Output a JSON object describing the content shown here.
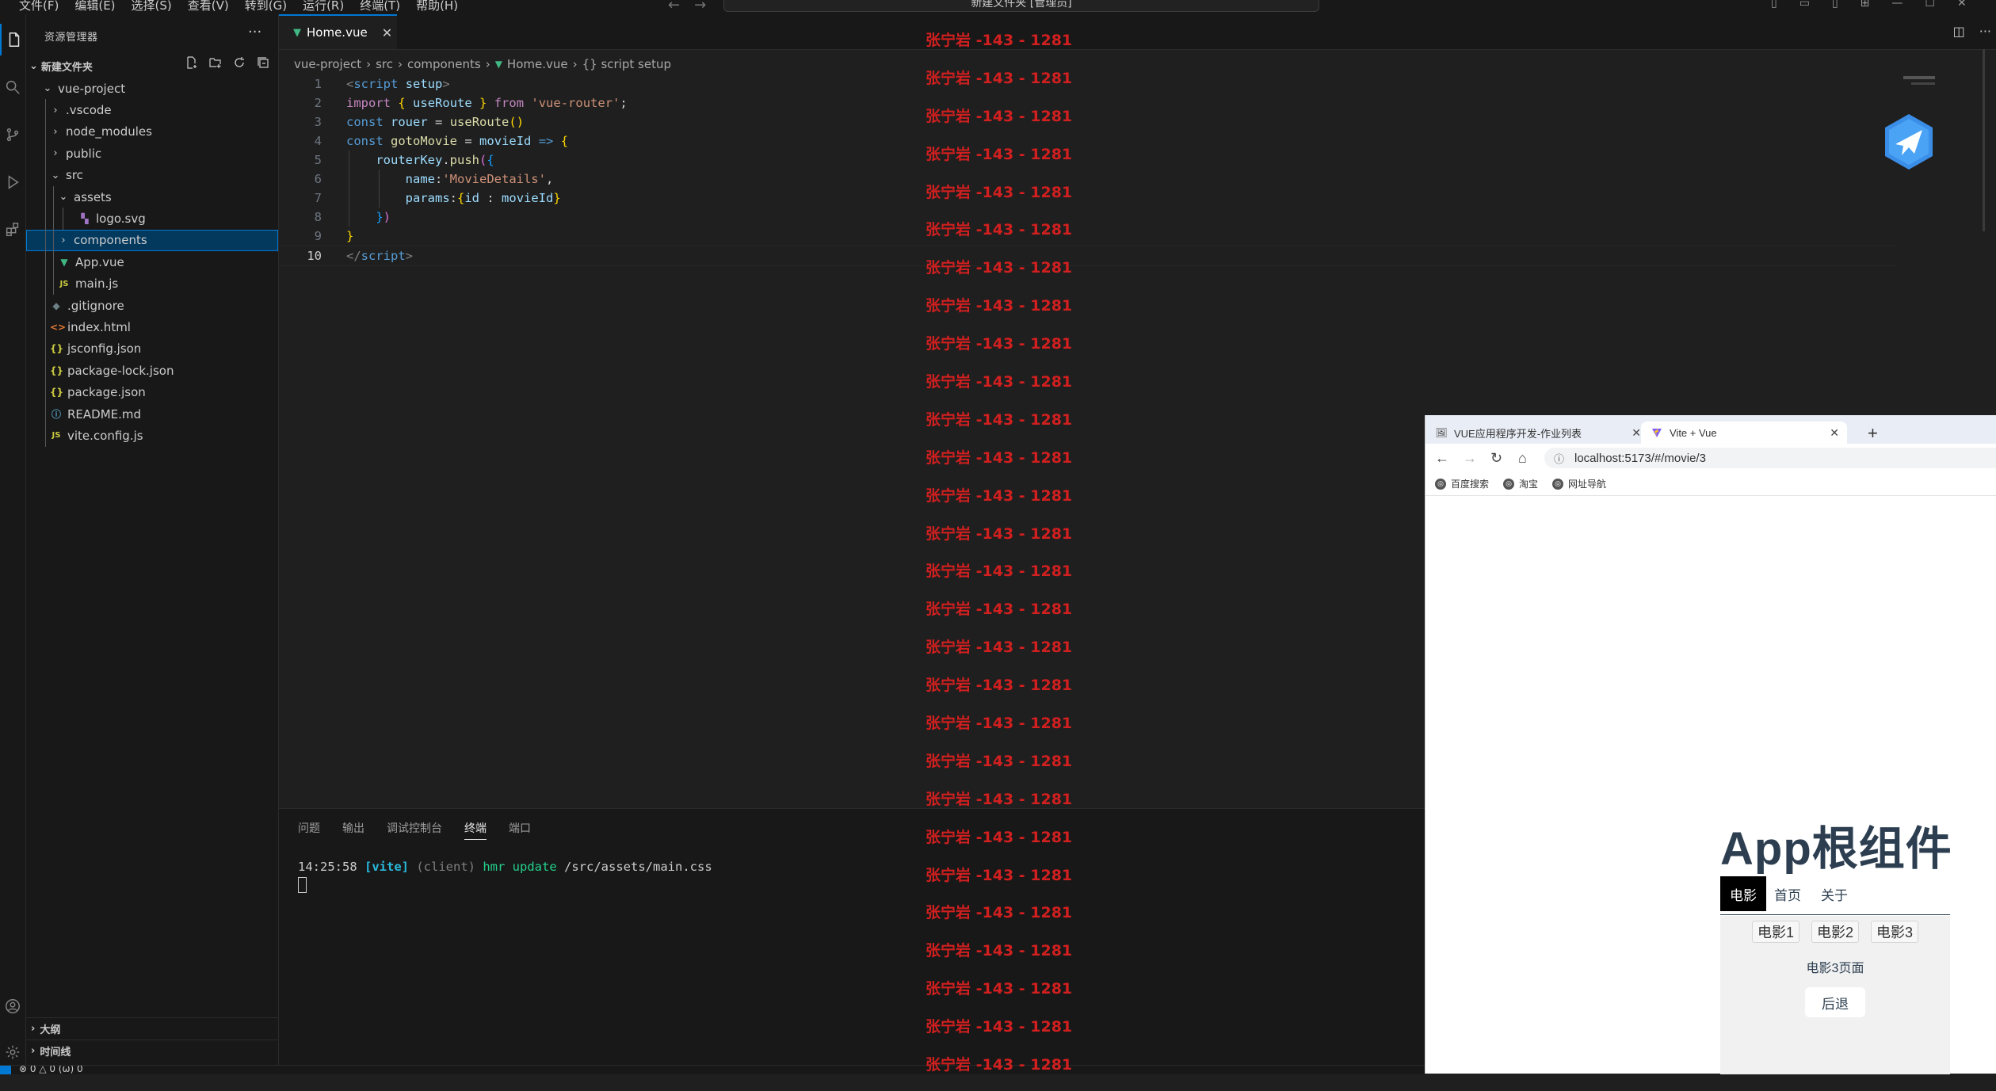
{
  "menu": [
    "文件(F)",
    "编辑(E)",
    "选择(S)",
    "查看(V)",
    "转到(G)",
    "运行(R)",
    "终端(T)",
    "帮助(H)"
  ],
  "command_center": "新建文件夹 [管理员]",
  "sidebar": {
    "title": "资源管理器",
    "folder": "新建文件夹",
    "tree": [
      {
        "label": "vue-project",
        "depth": 1,
        "type": "folder-open"
      },
      {
        "label": ".vscode",
        "depth": 2,
        "type": "folder"
      },
      {
        "label": "node_modules",
        "depth": 2,
        "type": "folder"
      },
      {
        "label": "public",
        "depth": 2,
        "type": "folder"
      },
      {
        "label": "src",
        "depth": 2,
        "type": "folder-open"
      },
      {
        "label": "assets",
        "depth": 3,
        "type": "folder-open"
      },
      {
        "label": "logo.svg",
        "depth": 4,
        "type": "svg"
      },
      {
        "label": "components",
        "depth": 3,
        "type": "folder",
        "selected": true
      },
      {
        "label": "App.vue",
        "depth": 3,
        "type": "vue"
      },
      {
        "label": "main.js",
        "depth": 3,
        "type": "js"
      },
      {
        "label": ".gitignore",
        "depth": 2,
        "type": "git"
      },
      {
        "label": "index.html",
        "depth": 2,
        "type": "html"
      },
      {
        "label": "jsconfig.json",
        "depth": 2,
        "type": "json"
      },
      {
        "label": "package-lock.json",
        "depth": 2,
        "type": "json"
      },
      {
        "label": "package.json",
        "depth": 2,
        "type": "json"
      },
      {
        "label": "README.md",
        "depth": 2,
        "type": "info"
      },
      {
        "label": "vite.config.js",
        "depth": 2,
        "type": "js"
      }
    ],
    "outline": "大纲",
    "timeline": "时间线"
  },
  "editor": {
    "tab": "Home.vue",
    "breadcrumb": [
      "vue-project",
      "src",
      "components",
      "Home.vue",
      "{} script setup"
    ]
  },
  "panel": {
    "tabs": [
      "问题",
      "输出",
      "调试控制台",
      "终端",
      "端口"
    ],
    "active_tab": 3,
    "terminal": {
      "time": "14:25:58",
      "tag": "[vite]",
      "client": "(client)",
      "hmr": "hmr update",
      "path": "/src/assets/main.css"
    }
  },
  "status": "⊗ 0 △ 0   (ω) 0",
  "watermark": "张宁岩 -143 - 1281",
  "browser": {
    "tab1": "VUE应用程序开发-作业列表",
    "tab2": "Vite + Vue",
    "url": "localhost:5173/#/movie/3",
    "bookmarks": [
      "百度搜索",
      "淘宝",
      "网址导航"
    ],
    "app": {
      "title": "App根组件",
      "nav": [
        "首页",
        "关于",
        "电影"
      ],
      "movies": [
        "电影1",
        "电影2",
        "电影3"
      ],
      "movie_page": "电影3页面",
      "back": "后退"
    }
  },
  "colors": {
    "accent": "#0078d4",
    "vue_green": "#41b883",
    "watermark": "#d21f1f"
  }
}
